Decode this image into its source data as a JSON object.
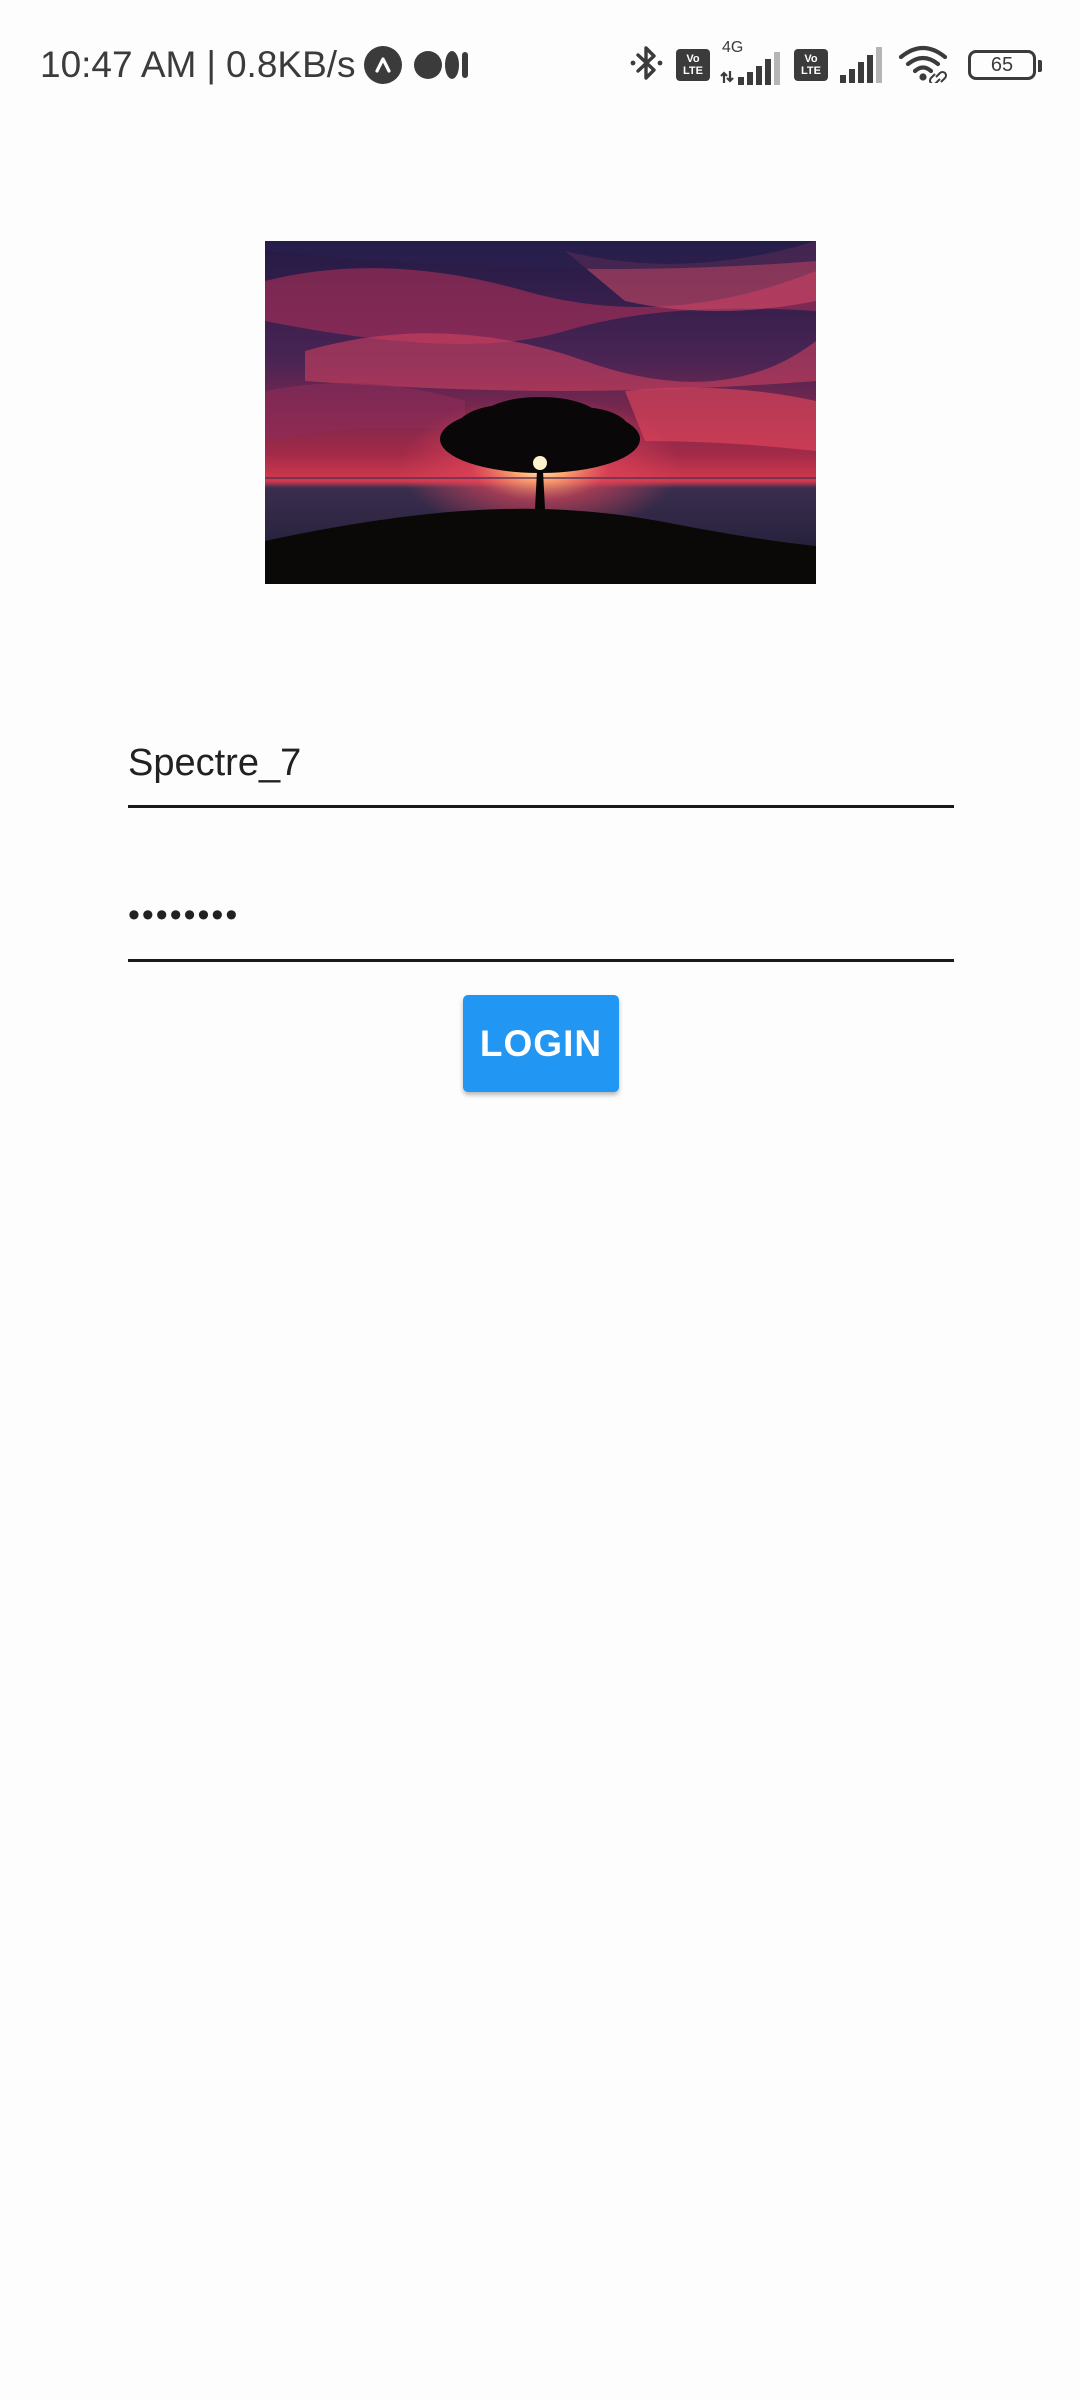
{
  "status_bar": {
    "time": "10:47 AM",
    "separator": "|",
    "net_speed": "0.8KB/s",
    "left_icons": [
      "app-notification-icon",
      "medium-icon"
    ],
    "right_icons": [
      "bluetooth-icon",
      "volte-icon",
      "signal-4g-icon",
      "volte-icon",
      "signal-icon",
      "wifi-icon",
      "battery-icon"
    ],
    "volte_line1": "Vo",
    "volte_line2": "LTE",
    "network_type": "4G",
    "battery_level": "65"
  },
  "hero": {
    "icon": "sunset-tree-image",
    "colors": {
      "sky_top": "#2a2350",
      "sky_red": "#c8304a",
      "sea": "#3a2e4e",
      "ground": "#0a0808",
      "sun": "#fff4d0"
    }
  },
  "form": {
    "username_value": "Spectre_7",
    "password_value": "••••••••",
    "login_label": "LOGIN"
  },
  "colors": {
    "accent": "#2196f3",
    "background": "#fdfdfd",
    "text": "#212121",
    "underline": "#1a1a1a"
  }
}
